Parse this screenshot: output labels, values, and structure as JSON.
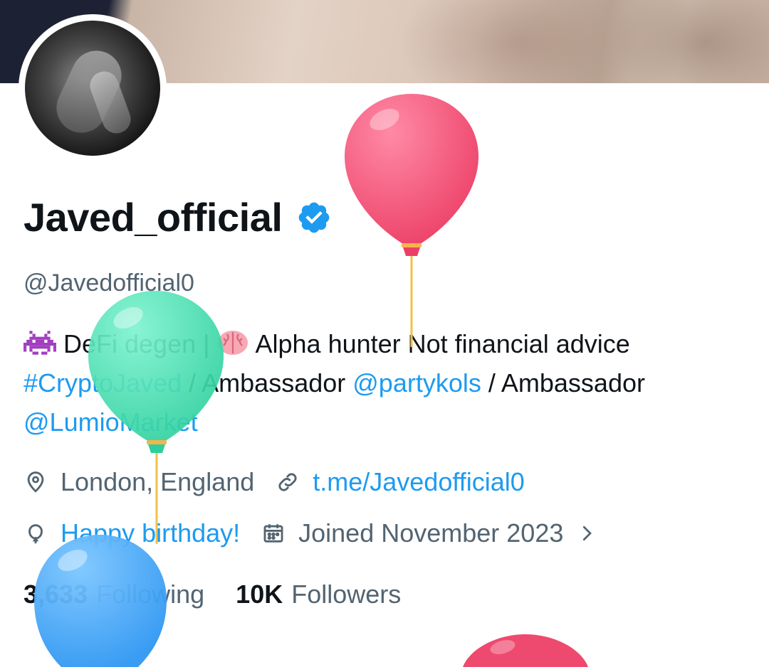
{
  "profile": {
    "display_name": "Javed_official",
    "handle": "@Javedofficial0",
    "verified_icon": "verified-badge-icon"
  },
  "bio": {
    "part1": " DeFi degen | ",
    "part2": " Alpha hunter Not financial advice ",
    "hashtag": "#CryptoJaved",
    "part3": " / Ambassador ",
    "mention1": "@partykols",
    "part4": " / Ambassador ",
    "mention2": "@LumioMarket",
    "emoji1": "alien-monster-icon",
    "emoji2": "brain-icon"
  },
  "meta": {
    "location": "London, England",
    "link": "t.me/Javedofficial0",
    "birthday": "Happy birthday!",
    "joined": "Joined November 2023"
  },
  "stats": {
    "following_count": "3,633",
    "following_label": "Following",
    "followers_count": "10K",
    "followers_label": "Followers"
  },
  "colors": {
    "accent": "#1d9bf0",
    "secondary_text": "#536471",
    "primary_text": "#0f1419",
    "balloon_pink": "#f25277",
    "balloon_green": "#4fe0b6",
    "balloon_blue": "#3ea5f7"
  }
}
